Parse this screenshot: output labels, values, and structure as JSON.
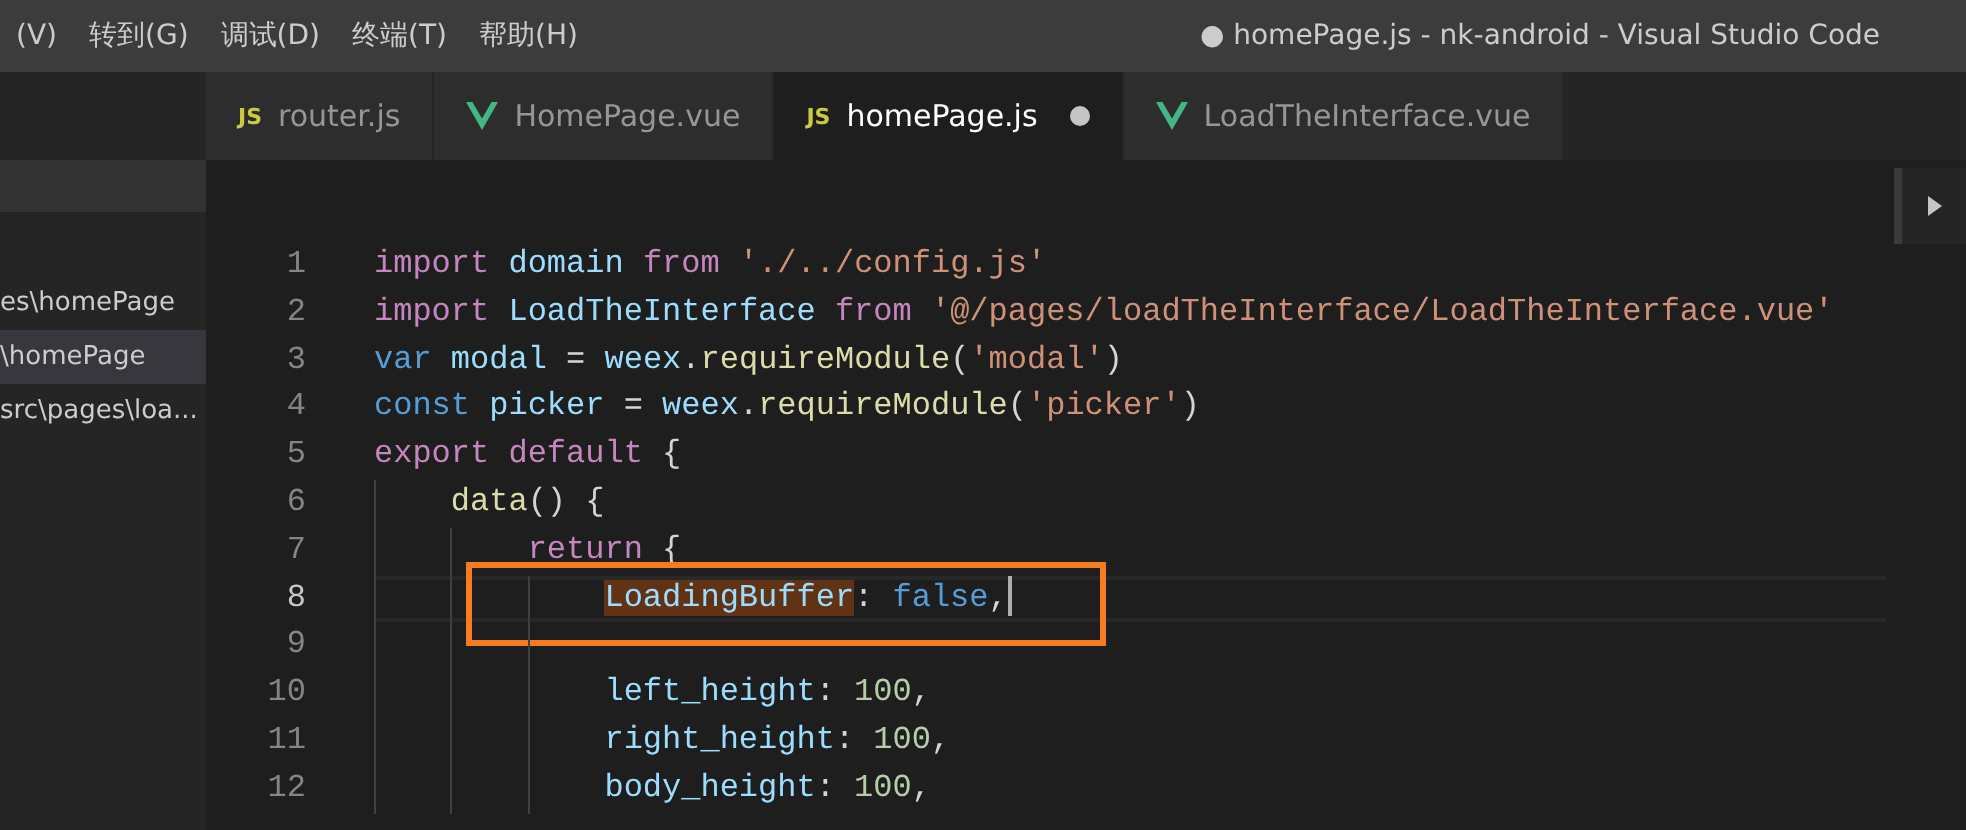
{
  "menu": [
    "(V)",
    "转到(G)",
    "调试(D)",
    "终端(T)",
    "帮助(H)"
  ],
  "window": {
    "title": "● homePage.js - nk-android - Visual Studio Code"
  },
  "sidebar": {
    "items": [
      {
        "label": "es\\homePage",
        "selected": false
      },
      {
        "label": "\\homePage",
        "selected": true
      },
      {
        "label": "src\\pages\\loa...",
        "selected": false
      }
    ]
  },
  "tabs": [
    {
      "kind": "js",
      "icon_label": "JS",
      "label": "router.js",
      "selected": false,
      "dirty": false
    },
    {
      "kind": "vue",
      "label": "HomePage.vue",
      "selected": false,
      "dirty": false
    },
    {
      "kind": "js",
      "icon_label": "JS",
      "label": "homePage.js",
      "selected": true,
      "dirty": true
    },
    {
      "kind": "vue",
      "label": "LoadTheInterface.vue",
      "selected": false,
      "dirty": false
    }
  ],
  "editor": {
    "lines": [
      {
        "number": "1",
        "current": false,
        "annotated": false,
        "cursor": false,
        "tokens": [
          {
            "text": "import",
            "kind": "keyword"
          },
          {
            "text": " domain",
            "kind": "variable"
          },
          {
            "text": " from",
            "kind": "keyword"
          },
          {
            "text": " './../config.js'",
            "kind": "string"
          }
        ]
      },
      {
        "number": "2",
        "current": false,
        "annotated": false,
        "cursor": false,
        "tokens": [
          {
            "text": "import",
            "kind": "keyword"
          },
          {
            "text": " LoadTheInterface",
            "kind": "variable"
          },
          {
            "text": " from",
            "kind": "keyword"
          },
          {
            "text": " '@/pages/loadTheInterface/LoadTheInterface.vue'",
            "kind": "string"
          }
        ]
      },
      {
        "number": "3",
        "current": false,
        "annotated": false,
        "cursor": false,
        "tokens": [
          {
            "text": "var",
            "kind": "storage"
          },
          {
            "text": " modal",
            "kind": "variable"
          },
          {
            "text": " = "
          },
          {
            "text": "weex",
            "kind": "variable"
          },
          {
            "text": "."
          },
          {
            "text": "requireModule",
            "kind": "function"
          },
          {
            "text": "("
          },
          {
            "text": "'modal'",
            "kind": "string"
          },
          {
            "text": ")"
          }
        ]
      },
      {
        "number": "4",
        "current": false,
        "annotated": false,
        "cursor": false,
        "tokens": [
          {
            "text": "const",
            "kind": "storage"
          },
          {
            "text": " picker",
            "kind": "variable"
          },
          {
            "text": " = "
          },
          {
            "text": "weex",
            "kind": "variable"
          },
          {
            "text": "."
          },
          {
            "text": "requireModule",
            "kind": "function"
          },
          {
            "text": "("
          },
          {
            "text": "'picker'",
            "kind": "string"
          },
          {
            "text": ")"
          }
        ]
      },
      {
        "number": "5",
        "current": false,
        "annotated": false,
        "cursor": false,
        "tokens": [
          {
            "text": "export",
            "kind": "keyword"
          },
          {
            "text": " default",
            "kind": "keyword"
          },
          {
            "text": " {"
          }
        ]
      },
      {
        "number": "6",
        "current": false,
        "annotated": false,
        "cursor": false,
        "tokens": [
          {
            "text": "    data",
            "kind": "function"
          },
          {
            "text": "() {"
          }
        ]
      },
      {
        "number": "7",
        "current": false,
        "annotated": false,
        "cursor": false,
        "tokens": [
          {
            "text": "        return",
            "kind": "keyword"
          },
          {
            "text": " {"
          }
        ]
      },
      {
        "number": "8",
        "current": true,
        "annotated": true,
        "cursor": true,
        "tokens": [
          {
            "text": "            LoadingBuffer",
            "kind": "variable",
            "highlighted": true
          },
          {
            "text": ": "
          },
          {
            "text": "false",
            "kind": "storage"
          },
          {
            "text": ","
          }
        ]
      },
      {
        "number": "9",
        "current": false,
        "annotated": false,
        "cursor": false
      },
      {
        "number": "10",
        "current": false,
        "annotated": false,
        "cursor": false,
        "tokens": [
          {
            "text": "            left_height",
            "kind": "variable"
          },
          {
            "text": ": "
          },
          {
            "text": "100",
            "kind": "number"
          },
          {
            "text": ","
          }
        ]
      },
      {
        "number": "11",
        "current": false,
        "annotated": false,
        "cursor": false,
        "tokens": [
          {
            "text": "            right_height",
            "kind": "variable"
          },
          {
            "text": ": "
          },
          {
            "text": "100",
            "kind": "number"
          },
          {
            "text": ","
          }
        ]
      },
      {
        "number": "12",
        "current": false,
        "annotated": false,
        "cursor": false,
        "tokens": [
          {
            "text": "            body_height",
            "kind": "variable"
          },
          {
            "text": ": "
          },
          {
            "text": "100",
            "kind": "number"
          },
          {
            "text": ","
          }
        ]
      }
    ]
  }
}
